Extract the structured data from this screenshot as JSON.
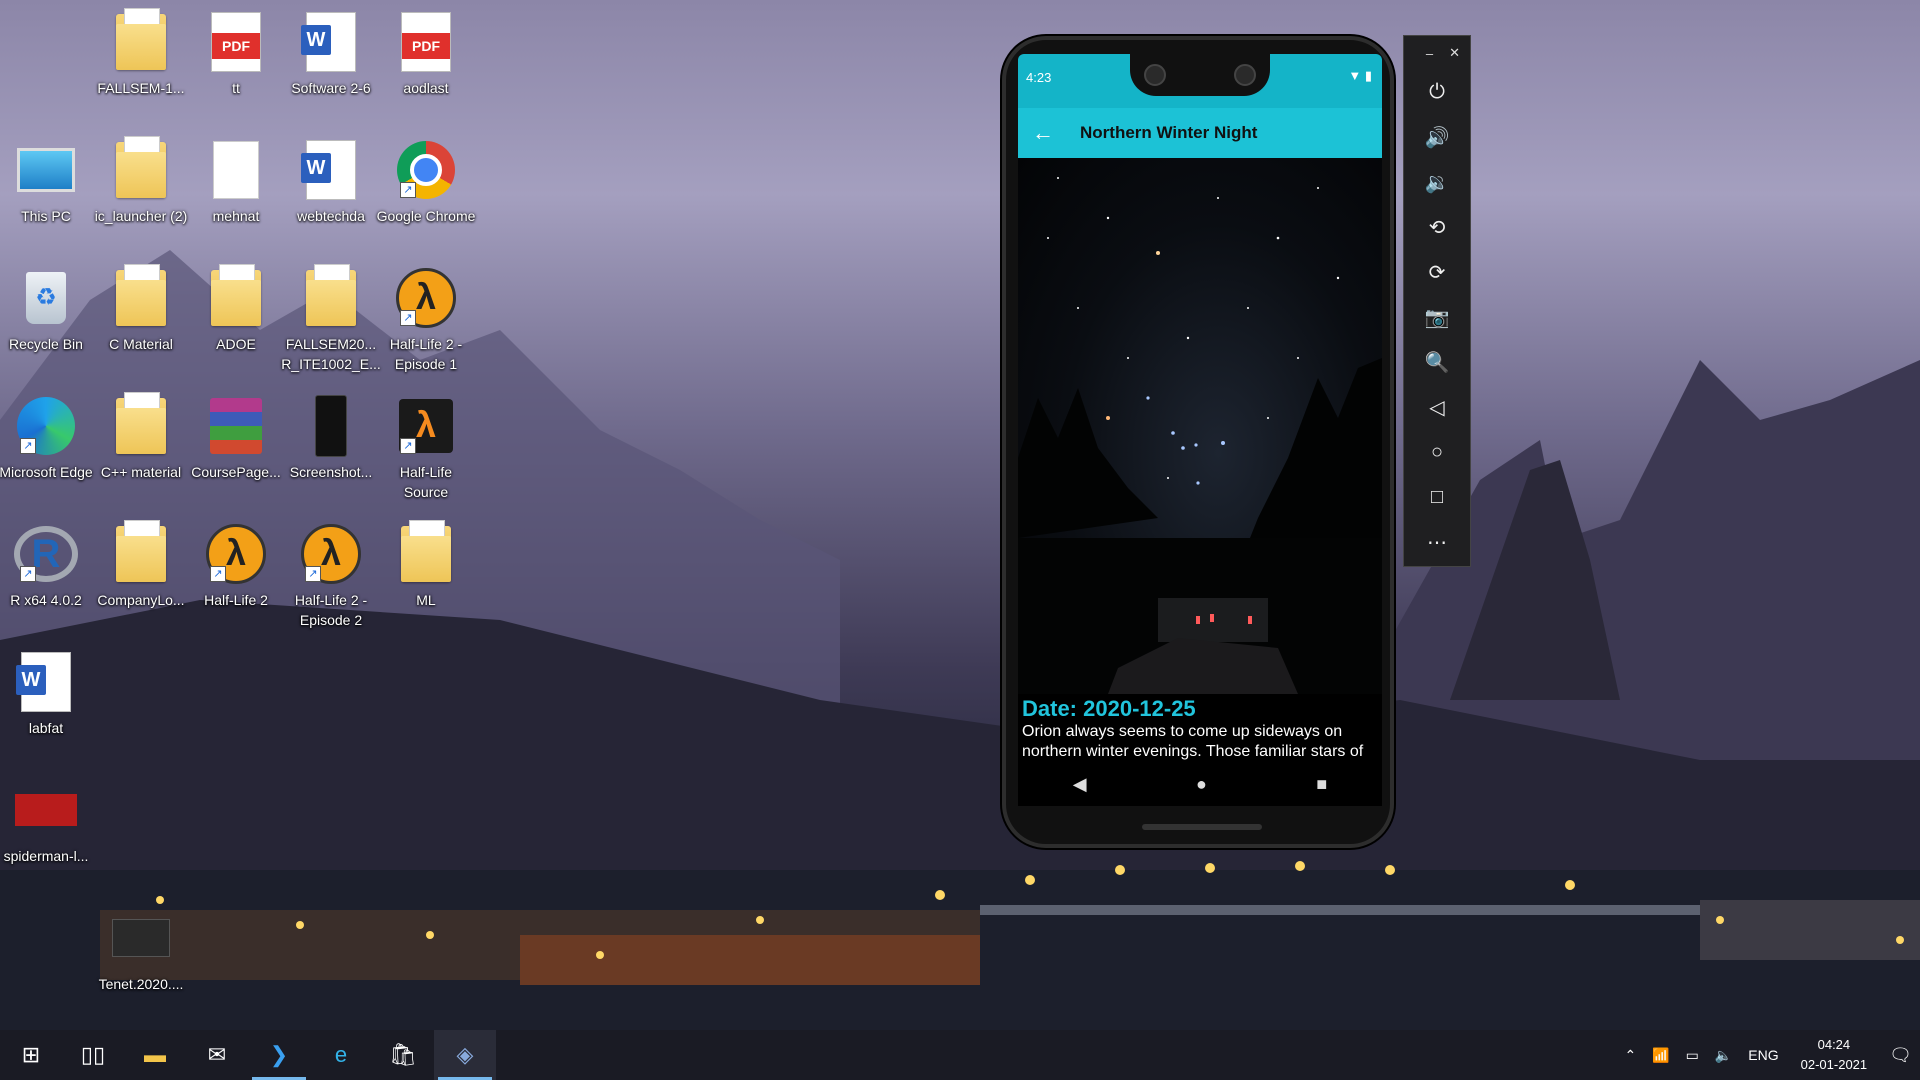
{
  "desktop": {
    "icons": [
      {
        "label": "FALLSEM-1...",
        "type": "folder"
      },
      {
        "label": "tt",
        "type": "pdf"
      },
      {
        "label": "Software 2-6",
        "type": "word"
      },
      {
        "label": "aodlast",
        "type": "pdf"
      },
      {
        "label": "This PC",
        "type": "pc"
      },
      {
        "label": "ic_launcher (2)",
        "type": "folder"
      },
      {
        "label": "mehnat",
        "type": "doc"
      },
      {
        "label": "webtechda",
        "type": "word"
      },
      {
        "label": "Google Chrome",
        "type": "chrome"
      },
      {
        "label": "Recycle Bin",
        "type": "recycle"
      },
      {
        "label": "C Material",
        "type": "folder"
      },
      {
        "label": "ADOE",
        "type": "folder"
      },
      {
        "label": "FALLSEM20... R_ITE1002_E...",
        "type": "folder"
      },
      {
        "label": "Half-Life 2 - Episode 1",
        "type": "lambda"
      },
      {
        "label": "Microsoft Edge",
        "type": "edge"
      },
      {
        "label": "C++ material",
        "type": "folder"
      },
      {
        "label": "CoursePage...",
        "type": "winrar"
      },
      {
        "label": "Screenshot...",
        "type": "image"
      },
      {
        "label": "Half-Life Source",
        "type": "lambda-square"
      },
      {
        "label": "R x64 4.0.2",
        "type": "r"
      },
      {
        "label": "CompanyLo...",
        "type": "folder"
      },
      {
        "label": "Half-Life 2",
        "type": "lambda"
      },
      {
        "label": "Half-Life 2 - Episode 2",
        "type": "lambda"
      },
      {
        "label": "ML",
        "type": "folder"
      },
      {
        "label": "labfat",
        "type": "word"
      },
      {
        "label": "spiderman-l...",
        "type": "image"
      },
      {
        "label": "Tenet.2020....",
        "type": "video"
      }
    ]
  },
  "emulator": {
    "status_time": "4:23",
    "app_title": "Northern Winter Night",
    "date_text": "Date: 2020-12-25",
    "description": "Orion always seems to come up sideways on northern winter evenings. Those familiar stars of the constellation of the Hunter...",
    "side_buttons": [
      "power-icon",
      "volume-up-icon",
      "volume-down-icon",
      "rotate-left-icon",
      "rotate-right-icon",
      "camera-icon",
      "zoom-icon",
      "back-icon",
      "home-icon",
      "overview-icon",
      "more-icon"
    ]
  },
  "taskbar": {
    "tray_language": "ENG",
    "clock_time": "04:24",
    "clock_date": "02-01-2021"
  }
}
